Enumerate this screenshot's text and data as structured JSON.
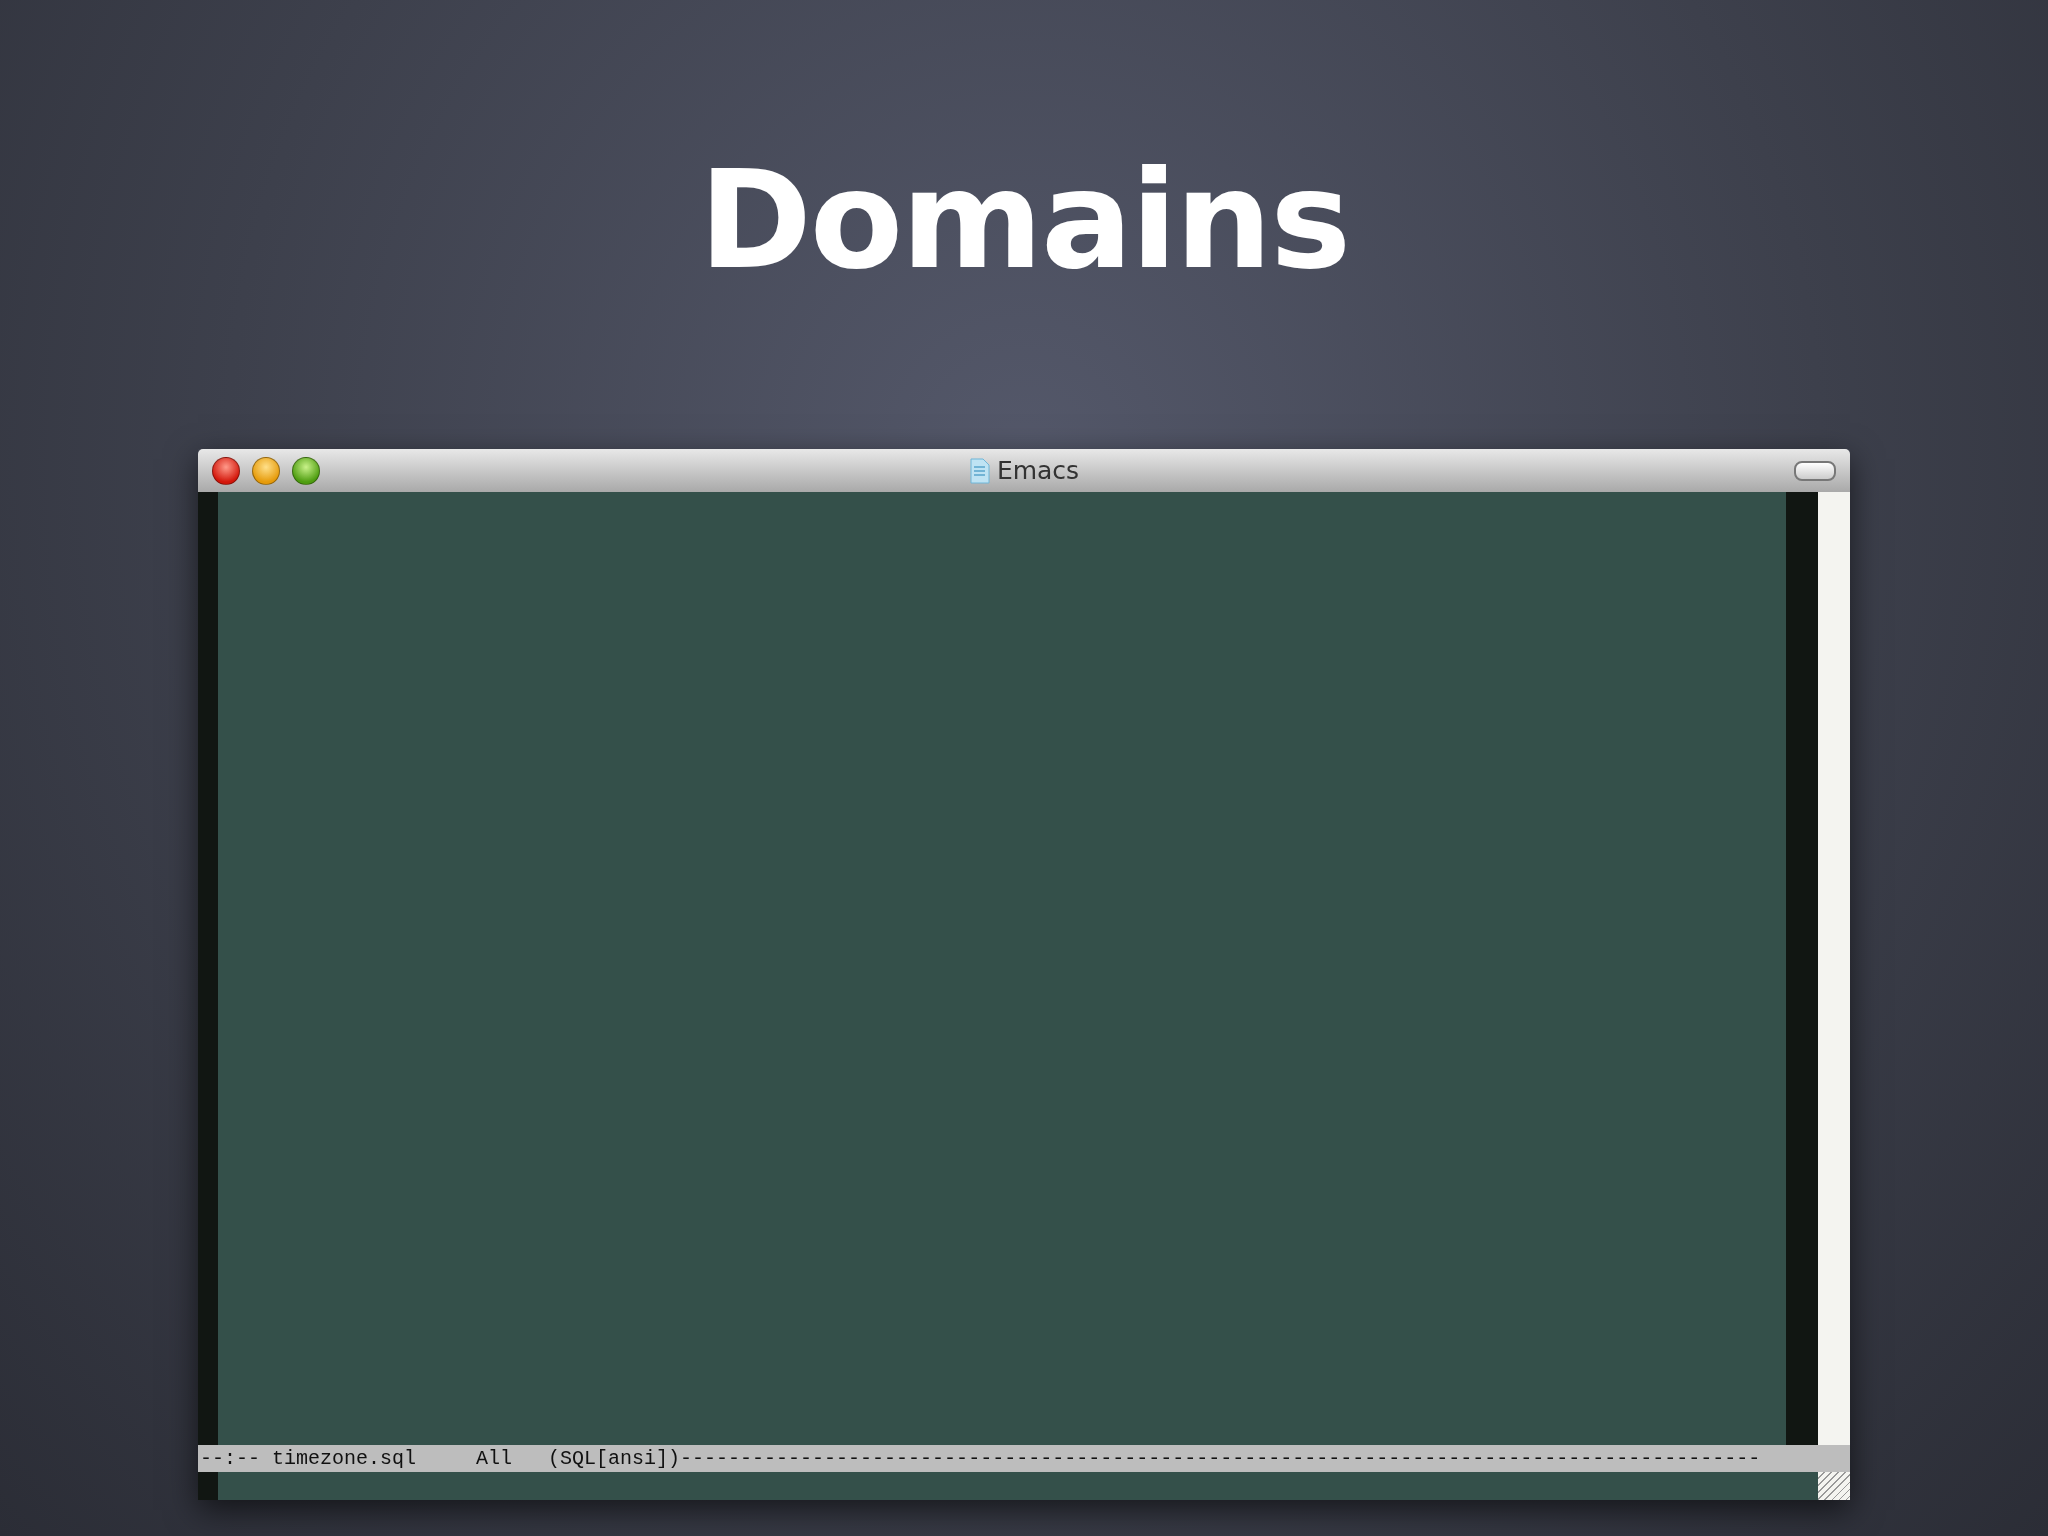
{
  "slide_title": "Domains",
  "window": {
    "title": "Emacs"
  },
  "mode_line": "--:-- timezone.sql     All   (SQL[ansi])------------------------------------------------------------------------------------------"
}
